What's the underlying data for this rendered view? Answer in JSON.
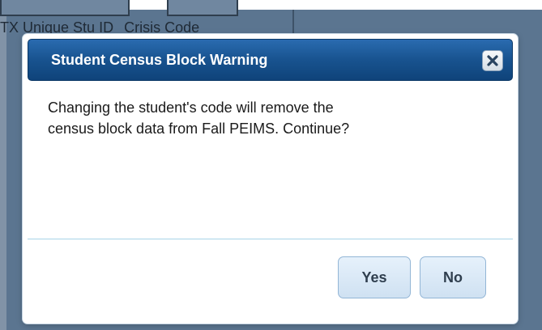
{
  "background": {
    "labels": [
      "TX Unique Stu ID",
      "Crisis Code"
    ]
  },
  "dialog": {
    "title": "Student Census Block Warning",
    "message_line1": "Changing the student's code will remove the",
    "message_line2": "census block data from Fall PEIMS. Continue?",
    "close_icon": "close-icon",
    "yes_label": "Yes",
    "no_label": "No"
  },
  "colors": {
    "header": "#18538f",
    "button": "#d9e9f7",
    "overlay": "#5b7590"
  }
}
